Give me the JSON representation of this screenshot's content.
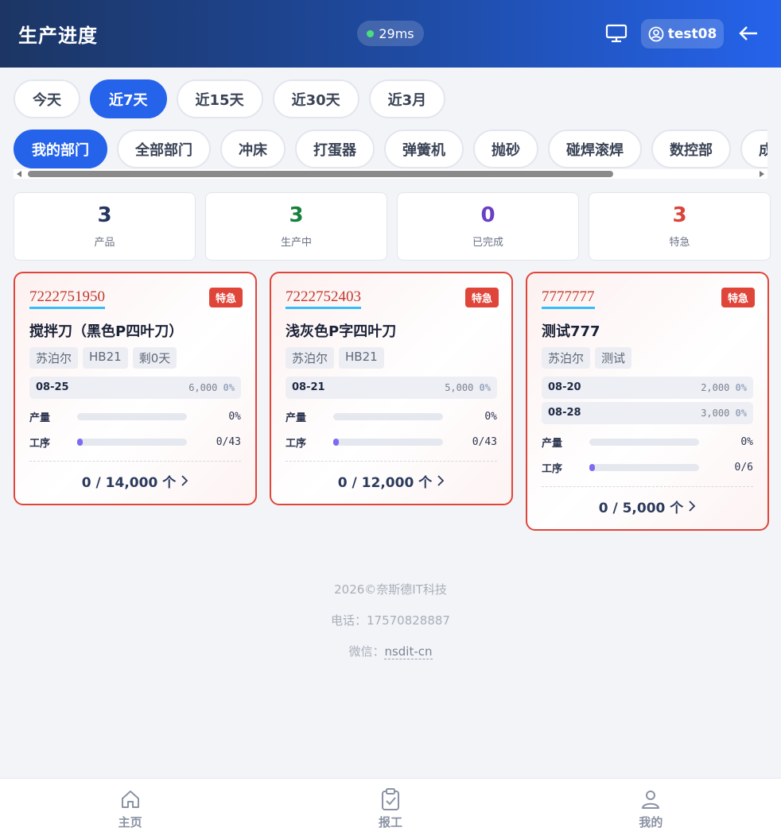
{
  "header": {
    "title": "生产进度",
    "latency": "29ms",
    "username": "test08",
    "icons": {
      "monitor": "monitor-icon",
      "user": "user-circle-icon",
      "back": "arrow-left-icon"
    }
  },
  "range_tabs": [
    {
      "label": "今天",
      "active": false
    },
    {
      "label": "近7天",
      "active": true
    },
    {
      "label": "近15天",
      "active": false
    },
    {
      "label": "近30天",
      "active": false
    },
    {
      "label": "近3月",
      "active": false
    }
  ],
  "dept_tabs": [
    {
      "label": "我的部门",
      "active": true
    },
    {
      "label": "全部部门",
      "active": false
    },
    {
      "label": "冲床",
      "active": false
    },
    {
      "label": "打蛋器",
      "active": false
    },
    {
      "label": "弹簧机",
      "active": false
    },
    {
      "label": "抛砂",
      "active": false
    },
    {
      "label": "碰焊滚焊",
      "active": false
    },
    {
      "label": "数控部",
      "active": false
    },
    {
      "label": "成",
      "active": false
    }
  ],
  "stats": [
    {
      "value": "3",
      "label": "产品",
      "color": "#25375f"
    },
    {
      "value": "3",
      "label": "生产中",
      "color": "#17803d"
    },
    {
      "value": "0",
      "label": "已完成",
      "color": "#6b3fc4"
    },
    {
      "value": "3",
      "label": "特急",
      "color": "#d9443b"
    }
  ],
  "cards": [
    {
      "code": "7222751950",
      "badge": "特急",
      "name": "搅拌刀（黑色P四叶刀）",
      "tags": [
        "苏泊尔",
        "HB21",
        "剩0天"
      ],
      "schedule": [
        {
          "date": "08-25",
          "qty": "6,000",
          "pct": "0%"
        }
      ],
      "output_label": "产量",
      "output_value": "0%",
      "output_progress": 0,
      "process_label": "工序",
      "process_value": "0/43",
      "process_progress": 0.04,
      "total": "0 / 14,000 个"
    },
    {
      "code": "7222752403",
      "badge": "特急",
      "name": "浅灰色P字四叶刀",
      "tags": [
        "苏泊尔",
        "HB21"
      ],
      "schedule": [
        {
          "date": "08-21",
          "qty": "5,000",
          "pct": "0%"
        }
      ],
      "output_label": "产量",
      "output_value": "0%",
      "output_progress": 0,
      "process_label": "工序",
      "process_value": "0/43",
      "process_progress": 0.04,
      "total": "0 / 12,000 个"
    },
    {
      "code": "7777777",
      "badge": "特急",
      "name": "测试777",
      "tags": [
        "苏泊尔",
        "测试"
      ],
      "schedule": [
        {
          "date": "08-20",
          "qty": "2,000",
          "pct": "0%"
        },
        {
          "date": "08-28",
          "qty": "3,000",
          "pct": "0%"
        }
      ],
      "output_label": "产量",
      "output_value": "0%",
      "output_progress": 0,
      "process_label": "工序",
      "process_value": "0/6",
      "process_progress": 0.02,
      "total": "0 / 5,000 个"
    }
  ],
  "footer": {
    "copyright": "2026©奈斯德IT科技",
    "phone": "电话：17570828887",
    "wechat_label": "微信：",
    "wechat_id": "nsdit-cn"
  },
  "bottom_nav": [
    {
      "label": "主页",
      "icon": "home-icon"
    },
    {
      "label": "报工",
      "icon": "clipboard-check-icon"
    },
    {
      "label": "我的",
      "icon": "person-icon"
    }
  ]
}
